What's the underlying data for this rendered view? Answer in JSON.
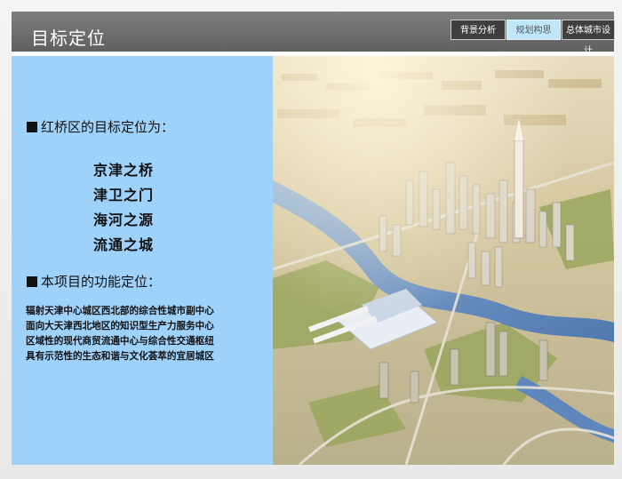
{
  "header": {
    "title": "目标定位"
  },
  "tabs": [
    {
      "label": "背景分析",
      "active": false
    },
    {
      "label": "规划构思",
      "active": true
    },
    {
      "label": "总体城市设计",
      "active": false
    }
  ],
  "left": {
    "heading1": "红桥区的目标定位为：",
    "goals": [
      "京津之桥",
      "津卫之门",
      "海河之源",
      "流通之城"
    ],
    "heading2": "本项目的功能定位：",
    "functions": [
      "辐射天津中心城区西北部的综合性城市副中心",
      "面向大天津西北地区的知识型生产力服务中心",
      "区域性的现代商贸流通中心与综合性交通枢纽",
      "具有示范性的生态和谐与文化荟萃的宜居城区"
    ]
  },
  "colors": {
    "header": "#6f6f6f",
    "panel": "#9fd2fb",
    "active_tab": "#bfe7fb"
  }
}
